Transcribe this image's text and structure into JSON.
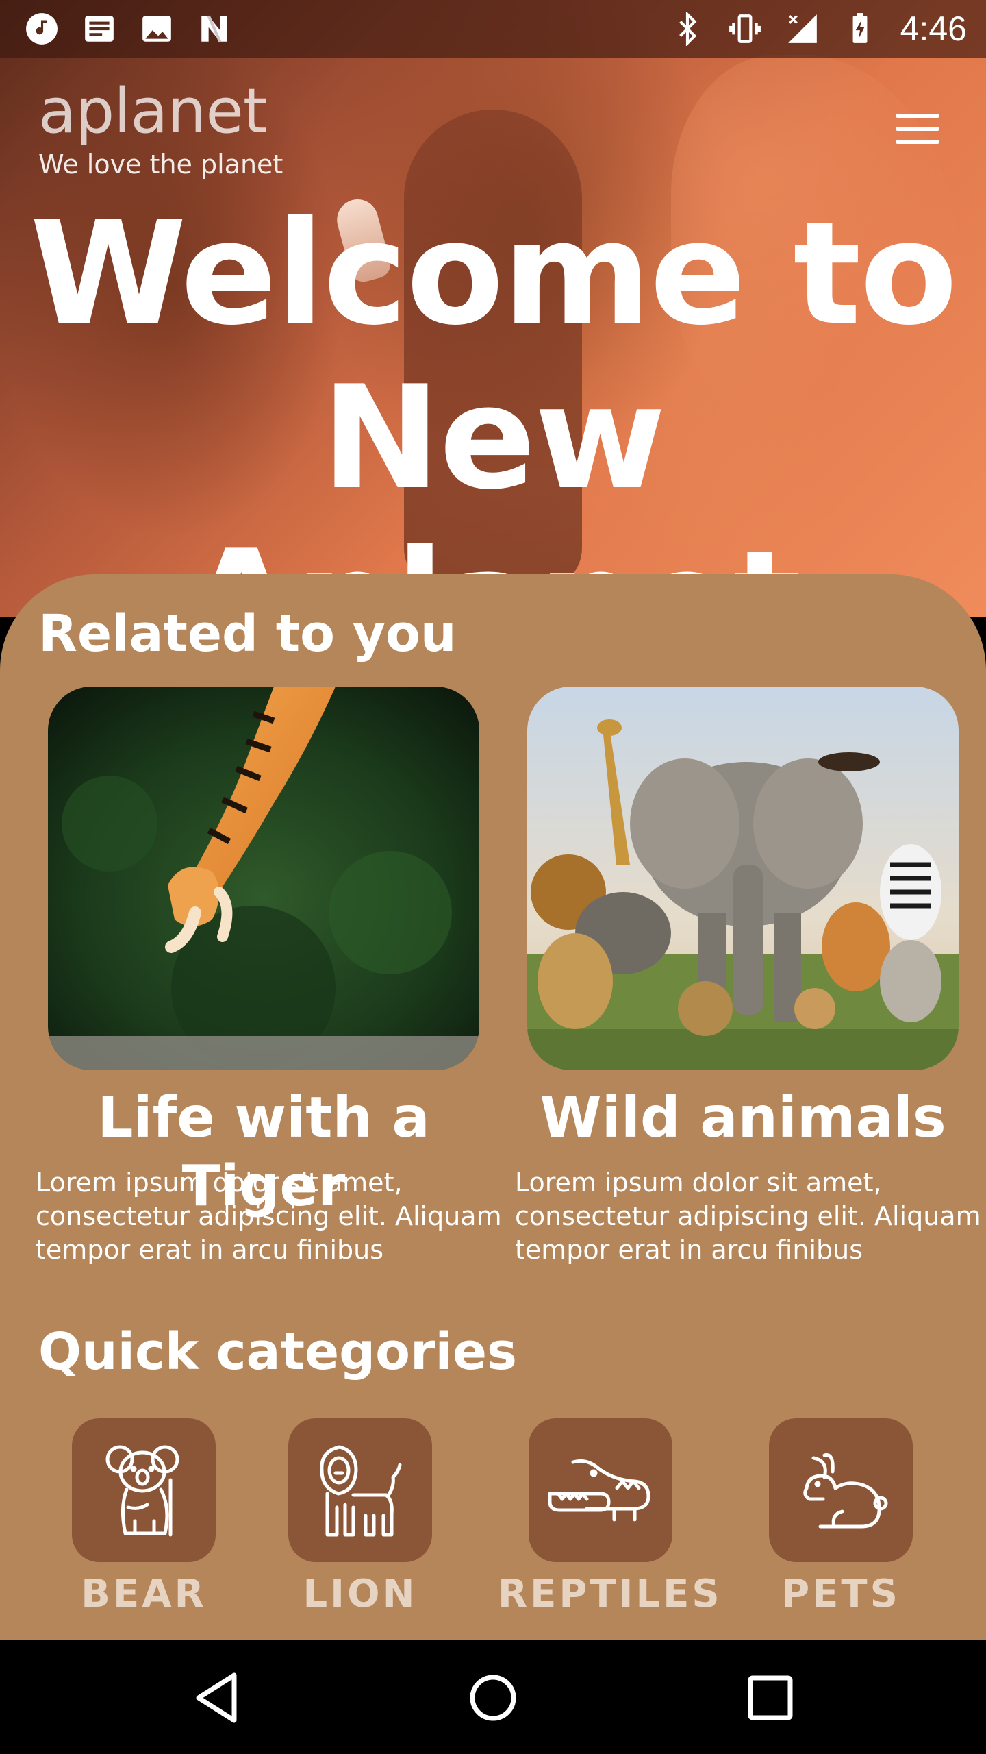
{
  "status_bar": {
    "time": "4:46",
    "left_icons": [
      "music-note-icon",
      "news-icon",
      "image-icon",
      "n-logo-icon"
    ],
    "right_icons": [
      "bluetooth-icon",
      "vibrate-icon",
      "signal-icon",
      "battery-charging-icon"
    ]
  },
  "header": {
    "brand": "aplanet",
    "tagline": "We love the planet",
    "menu_icon": "hamburger-menu-icon"
  },
  "hero": {
    "title_line1": "Welcome to",
    "title_line2": "New Aplanet"
  },
  "related": {
    "title": "Related to you",
    "cards": [
      {
        "title": "Life with a Tiger",
        "description": "Lorem ipsum dolor sit amet, consectetur adipiscing elit. Aliquam tempor erat in arcu finibus"
      },
      {
        "title": "Wild animals",
        "description": "Lorem ipsum dolor sit amet, consectetur adipiscing elit. Aliquam tempor erat in arcu finibus"
      }
    ]
  },
  "categories": {
    "title": "Quick categories",
    "items": [
      {
        "label": "BEAR",
        "icon": "koala-icon"
      },
      {
        "label": "LION",
        "icon": "lion-icon"
      },
      {
        "label": "REPTILES",
        "icon": "crocodile-icon"
      },
      {
        "label": "PETS",
        "icon": "rabbit-icon"
      }
    ]
  },
  "colors": {
    "sheet": "#b58659",
    "category_box": "#8b5637",
    "category_label": "#e6d3c1"
  }
}
